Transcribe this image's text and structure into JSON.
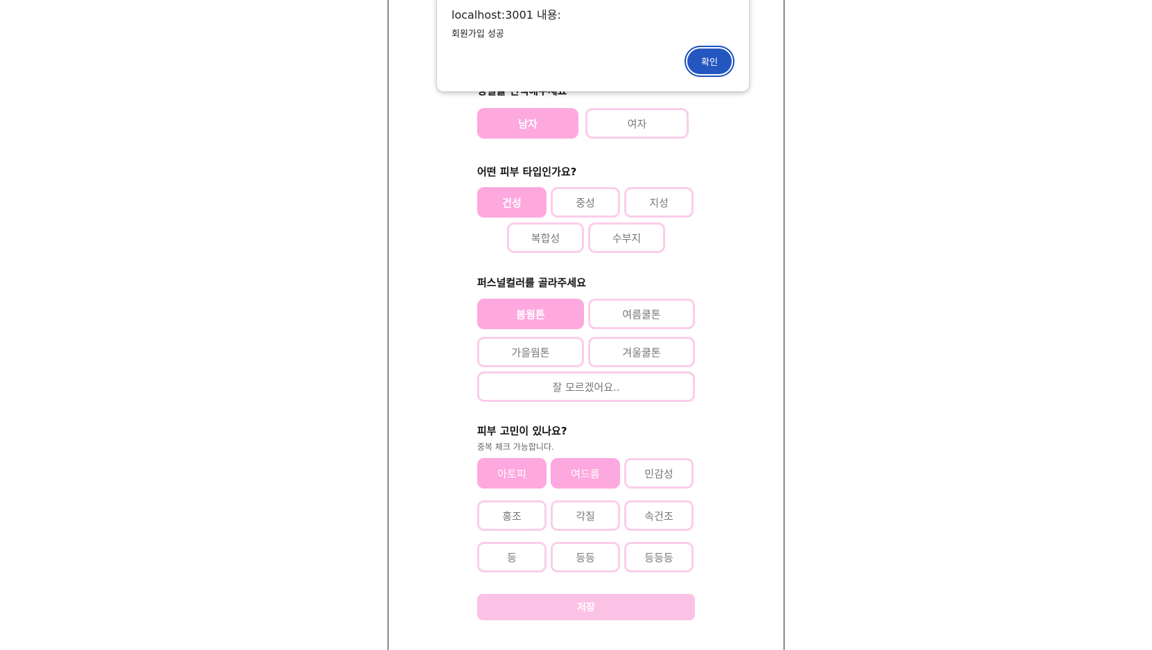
{
  "dialog": {
    "title": "localhost:3001 내용:",
    "message": "회원가입 성공",
    "ok_label": "확인"
  },
  "gender": {
    "title": "성별을 선택해주세요",
    "options": [
      "남자",
      "여자"
    ],
    "selected": "남자"
  },
  "skin_type": {
    "title": "어떤 피부 타입인가요?",
    "options": [
      "건성",
      "중성",
      "지성",
      "복합성",
      "수부지"
    ],
    "selected": "건성"
  },
  "personal_color": {
    "title": "퍼스널컬러를 골라주세요",
    "options": [
      "봄웜톤",
      "여름쿨톤",
      "가을웜톤",
      "겨울쿨톤",
      "잘 모르겠어요.."
    ],
    "selected": "봄웜톤"
  },
  "skin_concern": {
    "title": "피부 고민이 있나요?",
    "subtitle": "중복 체크 가능합니다.",
    "options": [
      "아토피",
      "여드름",
      "민감성",
      "홍조",
      "각질",
      "속건조",
      "등",
      "등등",
      "등등등"
    ],
    "selected": [
      "아토피",
      "여드름"
    ]
  },
  "save_label": "저장",
  "colors": {
    "accent": "#fda8de",
    "accent_border": "#fbcdea",
    "save_bg": "#fcc2e6",
    "dialog_button": "#2456c0"
  }
}
